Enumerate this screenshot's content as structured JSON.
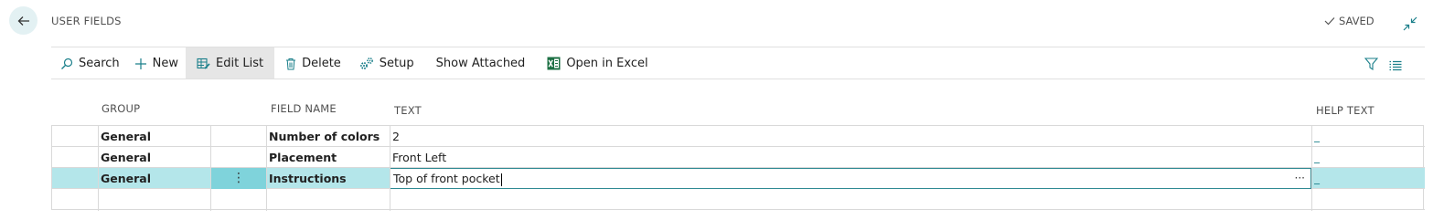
{
  "header": {
    "title": "USER FIELDS",
    "saved_label": "SAVED"
  },
  "actions": {
    "search": "Search",
    "new": "New",
    "edit_list": "Edit List",
    "delete": "Delete",
    "setup": "Setup",
    "show_attached": "Show Attached",
    "open_in_excel": "Open in Excel"
  },
  "columns": {
    "group": "GROUP",
    "field_name": "FIELD NAME",
    "text": "TEXT",
    "help_text": "HELP TEXT"
  },
  "rows": [
    {
      "group": "General",
      "field_name": "Number of colors",
      "text": "2",
      "help_text": "_"
    },
    {
      "group": "General",
      "field_name": "Placement",
      "text": "Front Left",
      "help_text": "_"
    },
    {
      "group": "General",
      "field_name": "Instructions",
      "text": "Top of front pocket",
      "help_text": "_",
      "row_menu": "⋮",
      "text_menu": "···"
    }
  ],
  "colors": {
    "accent": "#1a7f8a",
    "selected_row": "#b4e6ea",
    "row_menu_cell": "#7fd3db",
    "excel_green": "#1d7044"
  }
}
